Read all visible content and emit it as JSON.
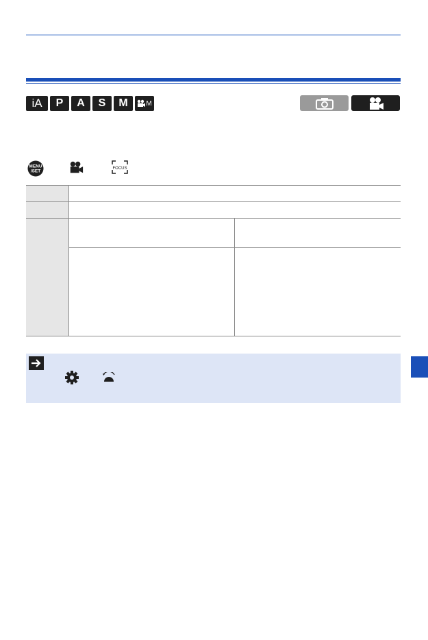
{
  "mode_icons": [
    "iA",
    "P",
    "A",
    "S",
    "M",
    "M"
  ],
  "camera_modes": {
    "photo_icon": "camera-icon",
    "video_icon": "movie-camera-icon",
    "active": "video"
  },
  "menu_path": {
    "menu_button_label": "MENU /SET",
    "tab_icon": "movie-camera-icon",
    "item_icon": "focus-icon",
    "item_icon_text": "FOCUS"
  },
  "table": {
    "rows": [
      {
        "label": "",
        "value": ""
      },
      {
        "label": "",
        "value": ""
      },
      {
        "label": "",
        "sub_rows": [
          {
            "name": "",
            "description": ""
          },
          {
            "name": "",
            "description": ""
          }
        ]
      }
    ]
  },
  "note": {
    "arrow_icon": "arrow-right-icon",
    "gear_icon": "gear-icon",
    "dial_icon": "dial-icon"
  },
  "colors": {
    "accent": "#1a4fb8",
    "heading_light": "#a9bfe6",
    "note_background": "#dde5f6",
    "icon_dark": "#1f1f1f",
    "photo_inactive": "#9a9a9a"
  }
}
